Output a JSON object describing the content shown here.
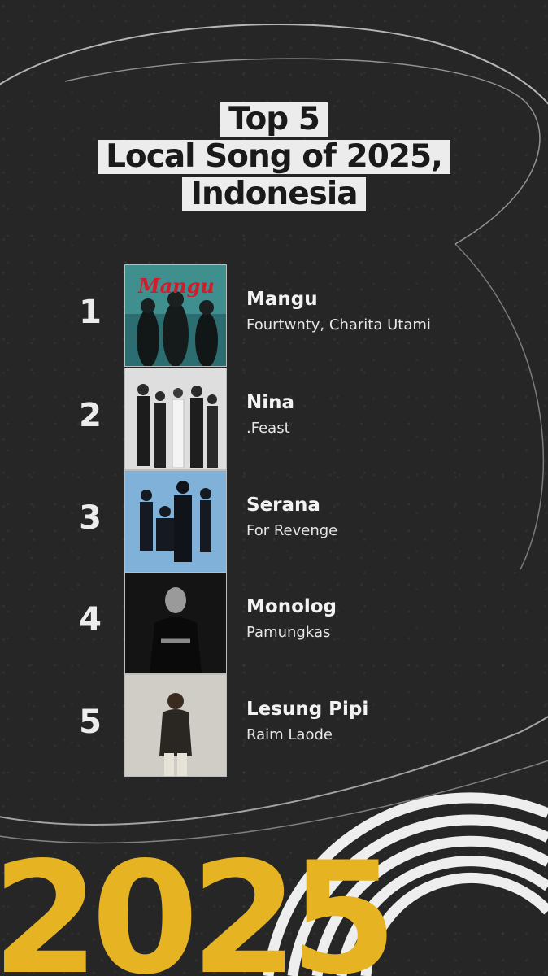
{
  "title": {
    "line1": "Top 5",
    "line2": "Local Song of 2025,",
    "line3": "Indonesia"
  },
  "songs": [
    {
      "rank": "1",
      "title": "Mangu",
      "artist": "Fourtwnty, Charita Utami",
      "cover_text": "Mangu",
      "cover_icon": "band-photo-teal"
    },
    {
      "rank": "2",
      "title": "Nina",
      "artist": ".Feast",
      "cover_icon": "band-photo-white"
    },
    {
      "rank": "3",
      "title": "Serana",
      "artist": "For Revenge",
      "cover_icon": "band-photo-blue"
    },
    {
      "rank": "4",
      "title": "Monolog",
      "artist": "Pamungkas",
      "cover_icon": "portrait-dark"
    },
    {
      "rank": "5",
      "title": "Lesung Pipi",
      "artist": "Raim Laode",
      "cover_icon": "portrait-light"
    }
  ],
  "year_graphic": "2025",
  "colors": {
    "background": "#262626",
    "title_box": "#ececec",
    "accent_yellow": "#e6b422",
    "text": "#f2f2f2"
  }
}
